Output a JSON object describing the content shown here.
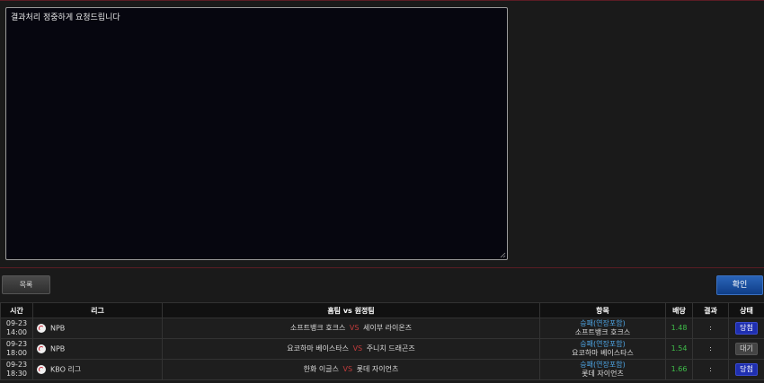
{
  "memo": {
    "text": "결과처리 정중하게 요청드립니다"
  },
  "buttons": {
    "list_label": "목록",
    "confirm_label": "확인"
  },
  "table": {
    "headers": [
      "시간",
      "리그",
      "홈팀 vs 원정팀",
      "항목",
      "배당",
      "결과",
      "상태"
    ],
    "rows": [
      {
        "date": "09-23",
        "time": "14:00",
        "league": "NPB",
        "home": "소프트뱅크 호크스",
        "vs": "VS",
        "away": "세이부 라이온즈",
        "market": "승패(연장포함)",
        "pick": "소프트뱅크 호크스",
        "odds": "1.48",
        "result": ":",
        "status": "당첨",
        "status_kind": "win"
      },
      {
        "date": "09-23",
        "time": "18:00",
        "league": "NPB",
        "home": "요코하마 베이스타스",
        "vs": "VS",
        "away": "주니치 드래곤즈",
        "market": "승패(연장포함)",
        "pick": "요코하마 베이스타스",
        "odds": "1.54",
        "result": ":",
        "status": "대기",
        "status_kind": "wait"
      },
      {
        "date": "09-23",
        "time": "18:30",
        "league": "KBO 리그",
        "home": "한화 이글스",
        "vs": "VS",
        "away": "롯데 자이언츠",
        "market": "승패(연장포함)",
        "pick": "롯데 자이언츠",
        "odds": "1.66",
        "result": ":",
        "status": "당첨",
        "status_kind": "win"
      }
    ]
  },
  "colors": {
    "accent_red": "#c23b3b",
    "odds_green": "#3fbf4a",
    "market_blue": "#4ea6e6",
    "confirm_blue": "#1a4fa0"
  },
  "icons": {
    "league": "baseball-icon"
  }
}
